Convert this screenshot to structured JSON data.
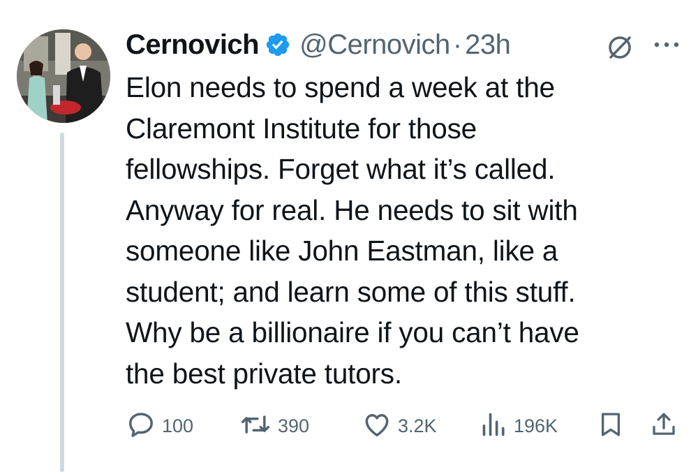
{
  "tweet": {
    "author_name": "Cernovich",
    "handle": "@Cernovich",
    "separator": "·",
    "time": "23h",
    "text_lines": [
      "Elon needs to spend a week at the",
      "Claremont Institute for those",
      "fellowships. Forget what it’s called.",
      "Anyway for real. He needs to sit with",
      "someone like John Eastman, like a",
      "student; and learn some of this stuff.",
      "Why be a billionaire if you can’t have",
      "the best private tutors."
    ]
  },
  "actions": {
    "replies": "100",
    "reposts": "390",
    "likes": "3.2K",
    "views": "196K"
  },
  "icons": {
    "verified": "verified-badge-icon",
    "grok": "grok-icon",
    "more": "more-icon",
    "reply": "reply-icon",
    "repost": "repost-icon",
    "like": "heart-icon",
    "views": "analytics-icon",
    "bookmark": "bookmark-icon",
    "share": "share-icon"
  },
  "colors": {
    "text": "#0f1419",
    "secondary": "#536471",
    "verified": "#1d9bf0",
    "thread_line": "#cfd9de"
  }
}
